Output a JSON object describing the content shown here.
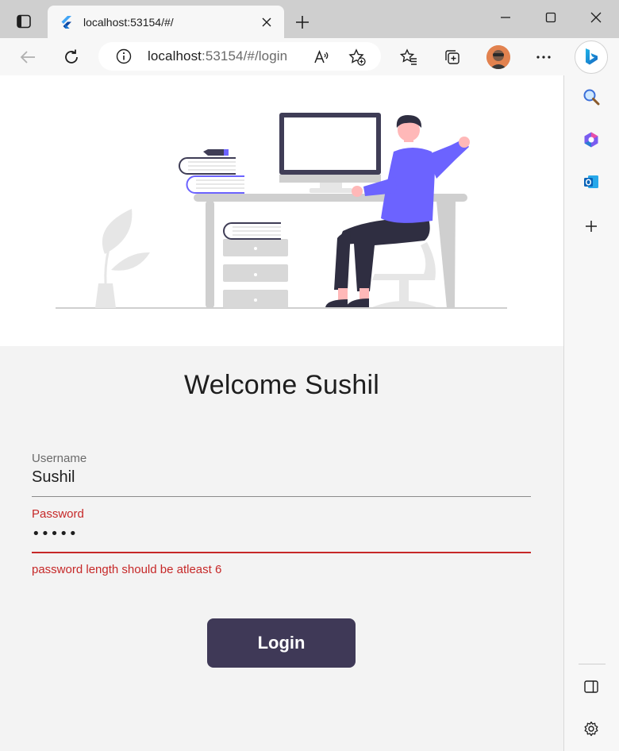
{
  "browser": {
    "tab": {
      "title": "localhost:53154/#/"
    },
    "address": {
      "host": "localhost",
      "path": ":53154/#/login"
    }
  },
  "page": {
    "heading": "Welcome Sushil",
    "username": {
      "label": "Username",
      "value": "Sushil"
    },
    "password": {
      "label": "Password",
      "masked_value": "•••••",
      "error": "password length should be atleast 6"
    },
    "login_button": "Login"
  },
  "colors": {
    "accent": "#6c63ff",
    "button": "#3f3957",
    "error": "#c62828"
  }
}
